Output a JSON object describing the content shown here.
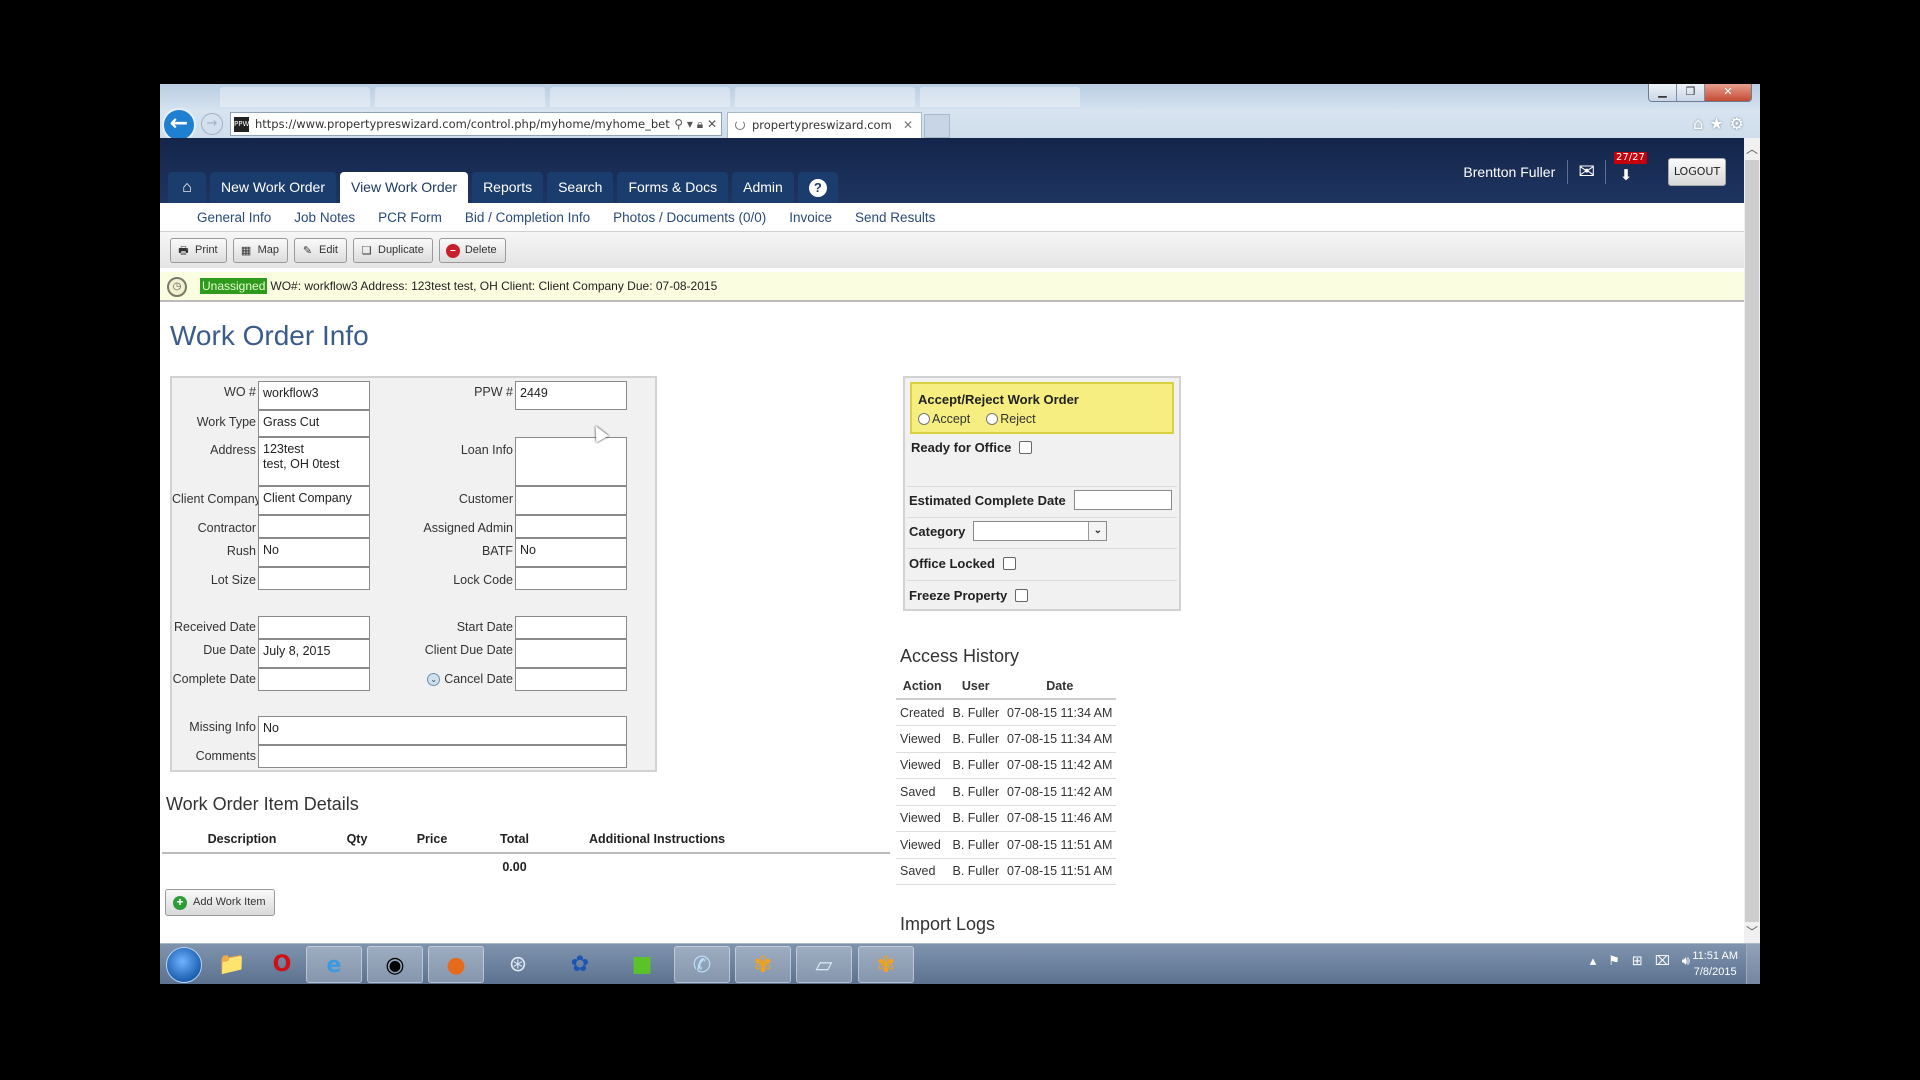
{
  "browser": {
    "url": "https://www.propertypreswizard.com/control.php/myhome/myhome_bet",
    "url_domain": "propertypreswizard.com",
    "favicon_text": "PPW",
    "tab_title": "propertypreswizard.com"
  },
  "header": {
    "nav_tabs": [
      {
        "label": "New Work Order",
        "active": false
      },
      {
        "label": "View Work Order",
        "active": true
      },
      {
        "label": "Reports",
        "active": false
      },
      {
        "label": "Search",
        "active": false
      },
      {
        "label": "Forms & Docs",
        "active": false
      },
      {
        "label": "Admin",
        "active": false
      }
    ],
    "help_label": "?",
    "user_name": "Brentton Fuller",
    "inbox_badge": "27/27",
    "logout_label": "LOGOUT"
  },
  "subnav": [
    "General Info",
    "Job Notes",
    "PCR Form",
    "Bid / Completion Info",
    "Photos / Documents (0/0)",
    "Invoice",
    "Send Results"
  ],
  "toolbar": {
    "print": "Print",
    "map": "Map",
    "edit": "Edit",
    "duplicate": "Duplicate",
    "delete": "Delete"
  },
  "status": {
    "badge": "Unassigned",
    "text": "WO#: workflow3 Address: 123test test, OH Client: Client Company Due: 07-08-2015",
    "badge_color": "#2e9a1e"
  },
  "page_title": "Work Order Info",
  "work_order": {
    "wo_label": "WO #",
    "wo_value": "workflow3",
    "ppw_label": "PPW #",
    "ppw_value": "2449",
    "work_type_label": "Work Type",
    "work_type_value": "Grass Cut",
    "address_label": "Address",
    "address_value": "123test\ntest, OH 0test",
    "loan_info_label": "Loan Info",
    "loan_info_value": "",
    "client_company_label": "Client Company",
    "client_company_value": "Client Company",
    "customer_label": "Customer",
    "customer_value": "",
    "contractor_label": "Contractor",
    "contractor_value": "",
    "assigned_admin_label": "Assigned Admin",
    "assigned_admin_value": "",
    "rush_label": "Rush",
    "rush_value": "No",
    "batf_label": "BATF",
    "batf_value": "No",
    "lot_size_label": "Lot Size",
    "lot_size_value": "",
    "lock_code_label": "Lock Code",
    "lock_code_value": "",
    "received_date_label": "Received Date",
    "received_date_value": "",
    "start_date_label": "Start Date",
    "start_date_value": "",
    "due_date_label": "Due Date",
    "due_date_value": "July 8, 2015",
    "client_due_date_label": "Client Due Date",
    "client_due_date_value": "",
    "complete_date_label": "Complete Date",
    "complete_date_value": "",
    "cancel_date_label": "Cancel Date",
    "cancel_date_value": "",
    "missing_info_label": "Missing Info",
    "missing_info_value": "No",
    "comments_label": "Comments",
    "comments_value": ""
  },
  "right_panel": {
    "accept_title": "Accept/Reject Work Order",
    "accept_label": "Accept",
    "reject_label": "Reject",
    "ready_for_office_label": "Ready for Office",
    "estimated_complete_label": "Estimated Complete Date",
    "category_label": "Category",
    "category_value": "",
    "office_locked_label": "Office Locked",
    "freeze_property_label": "Freeze Property",
    "accept_box_color": "#f6ee80"
  },
  "access_history": {
    "title": "Access History",
    "columns": [
      "Action",
      "User",
      "Date"
    ],
    "rows": [
      [
        "Created",
        "B. Fuller",
        "07-08-15 11:34 AM"
      ],
      [
        "Viewed",
        "B. Fuller",
        "07-08-15 11:34 AM"
      ],
      [
        "Viewed",
        "B. Fuller",
        "07-08-15 11:42 AM"
      ],
      [
        "Saved",
        "B. Fuller",
        "07-08-15 11:42 AM"
      ],
      [
        "Viewed",
        "B. Fuller",
        "07-08-15 11:46 AM"
      ],
      [
        "Viewed",
        "B. Fuller",
        "07-08-15 11:51 AM"
      ],
      [
        "Saved",
        "B. Fuller",
        "07-08-15 11:51 AM"
      ]
    ]
  },
  "import_logs": {
    "title": "Import Logs"
  },
  "item_details": {
    "title": "Work Order Item Details",
    "columns": [
      "Description",
      "Qty",
      "Price",
      "Total",
      "Additional Instructions"
    ],
    "total": "0.00",
    "add_button": "Add Work Item"
  },
  "taskbar": {
    "apps": [
      "start",
      "file-explorer",
      "opera",
      "internet-explorer",
      "chrome",
      "firefox",
      "safari",
      "settings-app",
      "green-app",
      "phone-app",
      "flower-app",
      "notepad",
      "flower-app-2"
    ],
    "time": "11:51 AM",
    "date": "7/8/2015"
  }
}
